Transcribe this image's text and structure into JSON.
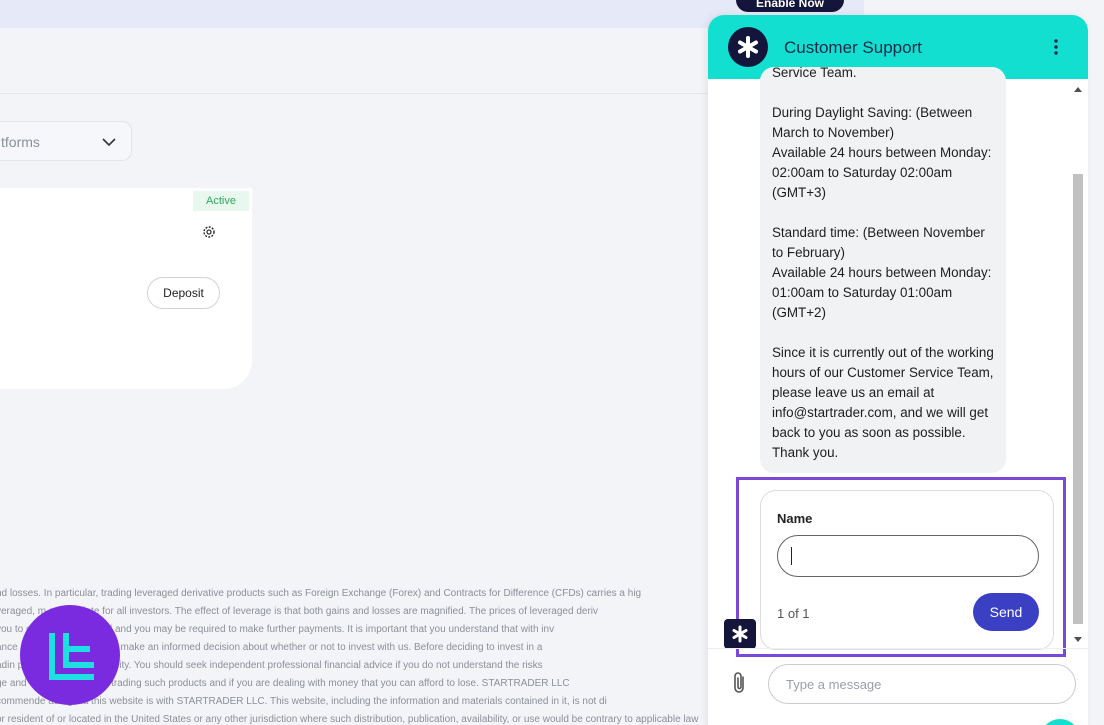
{
  "background": {
    "enable_button_label": "Enable Now",
    "platform_select_value": "tforms",
    "account_card": {
      "status_badge": "Active",
      "deposit_label": "Deposit"
    },
    "disclaimer_lines": [
      "nd losses. In particular, trading leveraged derivative products such as Foreign Exchange (Forex) and Contracts for Difference (CFDs) carries a hig",
      "veraged, m                   appropriate for all investors. The effect of leverage is that both gains and losses are magnified. The prices of leveraged deriv",
      "you to                   our invested capital and you may be required to make further payments. It is important that you understand that with inv",
      "ance                    ility to ensure that you make an informed decision about whether or not to invest with us. Before deciding to invest in a",
      "adin                    perience and affordability. You should seek independent professional financial advice if you do not understand the risks",
      "ge and                  e risks involved in trading such products and if you are dealing with money that you can afford to lose. STARTRADER LLC",
      "commende                ading via this website is with STARTRADER LLC. This website, including the information and materials contained in it, is not di",
      "or resident of or located in the United States or any other jurisdiction where such distribution, publication, availability, or use would be contrary to applicable law"
    ]
  },
  "chat": {
    "title": "Customer Support",
    "message_top_clipped": "Service Team.",
    "message_paragraphs": [
      "During Daylight Saving: (Between March to November)\nAvailable 24 hours between Monday: 02:00am to Saturday 02:00am (GMT+3)",
      "Standard time: (Between November to February)\nAvailable 24 hours between Monday: 01:00am to Saturday 01:00am (GMT+2)",
      "Since it is currently out of the working hours of our Customer Service Team, please leave us an email at info@startrader.com, and we will get back to you as soon as possible. Thank you."
    ],
    "form": {
      "name_label": "Name",
      "name_value": "",
      "page_indicator": "1 of 1",
      "send_label": "Send"
    },
    "composer_placeholder": "Type a message"
  },
  "colors": {
    "header": "#12dfd0",
    "send_button": "#3a3fc4",
    "highlight": "#7a49d8",
    "logo": "#7a2be0",
    "active_badge_text": "#2eaa5a"
  },
  "icons": [
    "chevron-down-icon",
    "gear-icon",
    "bot-avatar-icon",
    "kebab-menu-icon",
    "paperclip-icon",
    "scroll-up-icon",
    "scroll-down-icon",
    "brand-logo-icon"
  ]
}
